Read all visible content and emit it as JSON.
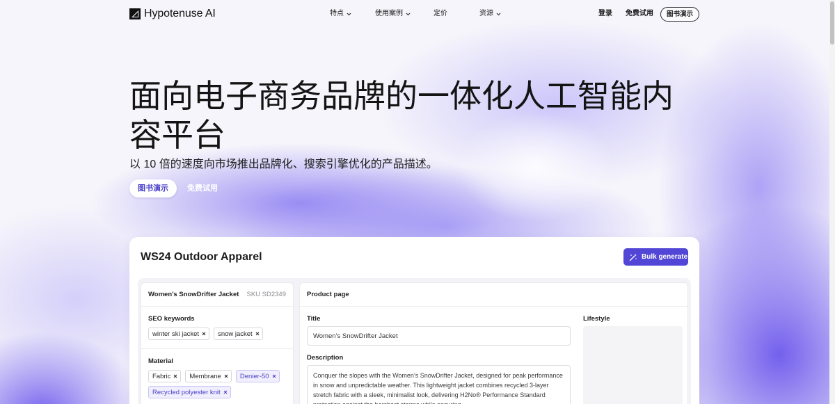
{
  "nav": {
    "logo_text": "Hypotenuse AI",
    "items": [
      {
        "label": "特点",
        "has_dropdown": true
      },
      {
        "label": "使用案例",
        "has_dropdown": true
      },
      {
        "label": "定价",
        "has_dropdown": false
      },
      {
        "label": "资源",
        "has_dropdown": true
      }
    ],
    "login_label": "登录",
    "free_trial_label": "免费试用",
    "demo_button_label": "图书演示"
  },
  "hero": {
    "title": "面向电子商务品牌的一体化人工智能内容平台",
    "subtitle": "以 10 倍的速度向市场推出品牌化、搜索引擎优化的产品描述。",
    "primary_cta_label": "图书演示",
    "secondary_cta_label": "免费试用"
  },
  "demo_card": {
    "title": "WS24 Outdoor Apparel",
    "bulk_generate_label": "Bulk generate",
    "product_panel": {
      "product_name": "Women’s SnowDrifter Jacket",
      "sku": "SKU SD2349",
      "sections": [
        {
          "label": "SEO keywords",
          "tags": [
            {
              "text": "winter ski jacket",
              "highlighted": false
            },
            {
              "text": "snow jacket",
              "highlighted": false
            }
          ]
        },
        {
          "label": "Material",
          "tags": [
            {
              "text": "Fabric",
              "highlighted": false
            },
            {
              "text": "Membrane",
              "highlighted": false
            },
            {
              "text": "Denier-50",
              "highlighted": true
            },
            {
              "text": "Recycled polyester knit",
              "highlighted": true
            }
          ]
        }
      ]
    },
    "output_panel": {
      "header": "Product page",
      "title_label": "Title",
      "title_value": "Women’s SnowDrifter Jacket",
      "description_label": "Description",
      "description_value": "Conquer the slopes with the Women’s SnowDrifter Jacket, designed for peak performance in snow and unpredictable weather. This lightweight jacket combines recycled 3-layer stretch fabric with a sleek, minimalist look, delivering H2No® Performance Standard protection against the harshest storms while ensuring",
      "lifestyle_label": "Lifestyle"
    }
  },
  "colors": {
    "accent": "#5246d6",
    "accent_text": "#4a3fc8",
    "page_background": "#f6f5fb",
    "text_primary": "#141414",
    "tag_highlight_bg": "#f1effd",
    "tag_highlight_border": "#c9c3f3"
  },
  "icons": {
    "logo": "hypotenuse-logo-icon",
    "nav_dropdown": "chevron-down-icon",
    "bulk_generate": "magic-wand-icon",
    "tag_remove": "close-icon"
  }
}
